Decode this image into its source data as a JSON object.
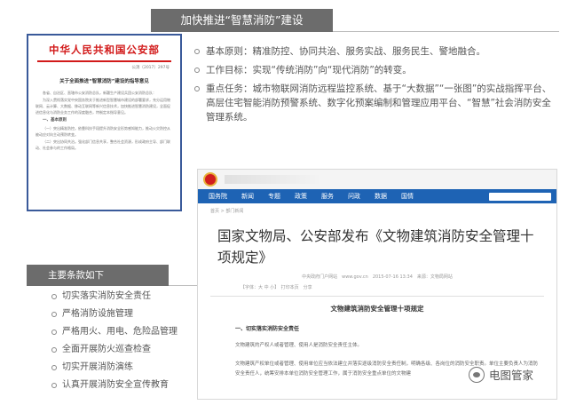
{
  "document": {
    "header": "中华人民共和国公安部",
    "number": "公消〔2017〕297号",
    "title": "关于全面推进“智慧消防”建设的指导意见",
    "paragraphs": [
      "各省、自治区、直辖市公安消防总队，新疆生产建设兵团公安消防总队：",
      "为深入贯彻落实党中央国务院关于推进新型智慧城市建设的部署要求，充分运用物联网、云计算、大数据、移动互联网等新兴信息技术，加快推进智慧消防建设，全面促进信息化与消防业务工作的深度融合，特制定本指导意见。",
      "一、基本原则",
      "（一）突出精准防控。依靠科技手段提升消防安全形势感知能力，推动火灾防控从被动应对向主动预防转变。",
      "（二）突出协同共治。强化部门信息共享，整合社会资源，形成政府主导、部门联动、社会参与的工作格局。"
    ]
  },
  "top_bar": {
    "title": "加快推进“智慧消防”建设"
  },
  "bullets": [
    "基本原则：精准防控、协同共治、服务实战、服务民生、警地融合。",
    "工作目标：实现“传统消防”向“现代消防”的转变。",
    "重点任务：城市物联网消防远程监控系统、基于“大数据”“一张图”的实战指挥平台、高层住宅智能消防预警系统、数字化预案编制和管理应用平台、“智慧”社会消防安全管理系统。"
  ],
  "website": {
    "nav": [
      "国务院",
      "新闻",
      "专题",
      "政策",
      "服务",
      "问政",
      "数据",
      "国情"
    ],
    "breadcrumb": "首页 > 部门新闻",
    "title": "国家文物局、公安部发布《文物建筑消防安全管理十项规定》",
    "meta": "中央政府门户网站　www.gov.cn　2015-07-16 13:34　来源：文物局网站",
    "tools": "【字体：大 中 小】　打印本页　分享",
    "doc_title": "文物建筑消防安全管理十项规定",
    "section": "一、切实落实消防安全责任",
    "paragraphs": [
      "文物建筑的产权人或者管理、使用人是消防安全责任主体。",
      "文物建筑产权单位或者管理、使用单位应当依法建立并落实逐级消防安全责任制，明确各级、各岗位的消防安全职责。单位主要负责人为消防安全责任人，统筹安排本单位消防安全管理工作，属于消防安全重点单位的文物建"
    ]
  },
  "watermark": {
    "text": "电图管家",
    "icon": "wechat-icon"
  },
  "bottom_bar": {
    "title": "主要条款如下"
  },
  "clauses": [
    "切实落实消防安全责任",
    "严格消防设施管理",
    "严格用火、用电、危险品管理",
    "全面开展防火巡查检查",
    "切实开展消防演练",
    "认真开展消防安全宣传教育"
  ],
  "colors": {
    "header_bar": "#6c6c6c",
    "doc_red": "#d21a1a",
    "doc_border": "#3a5a9a",
    "nav_blue": "#1e63b4"
  }
}
